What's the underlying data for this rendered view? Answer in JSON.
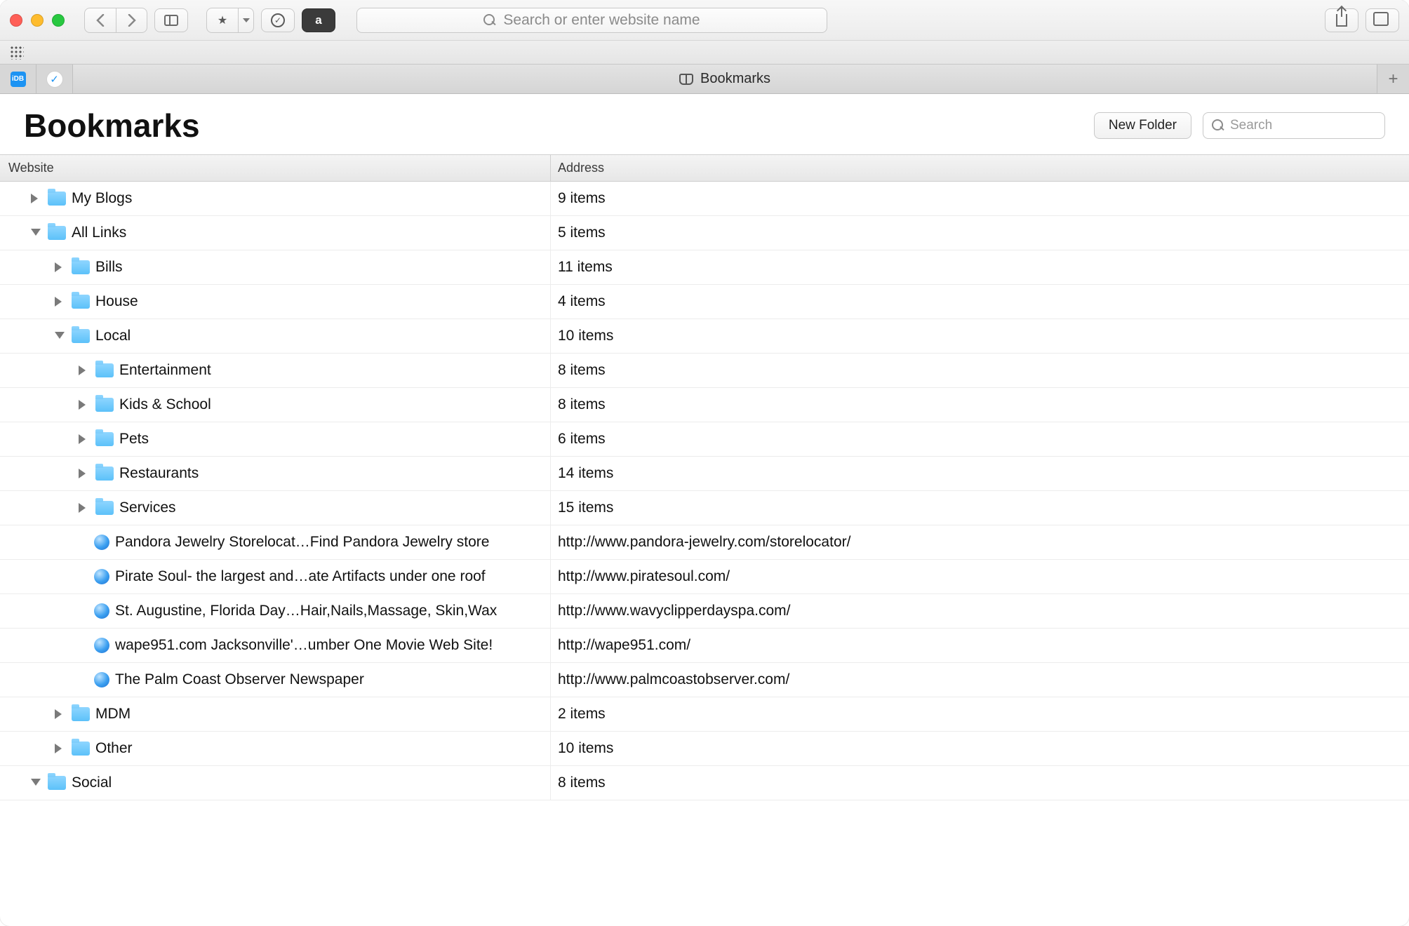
{
  "toolbar": {
    "address_placeholder": "Search or enter website name",
    "pinned_label": "iDB"
  },
  "tab": {
    "title": "Bookmarks"
  },
  "page": {
    "heading": "Bookmarks",
    "new_folder_label": "New Folder",
    "search_placeholder": "Search"
  },
  "columns": {
    "website": "Website",
    "address": "Address"
  },
  "rows": [
    {
      "indent": 0,
      "type": "folder",
      "expanded": false,
      "name": "My Blogs",
      "address": "9 items"
    },
    {
      "indent": 0,
      "type": "folder",
      "expanded": true,
      "name": "All Links",
      "address": "5 items"
    },
    {
      "indent": 1,
      "type": "folder",
      "expanded": false,
      "name": "Bills",
      "address": "11 items"
    },
    {
      "indent": 1,
      "type": "folder",
      "expanded": false,
      "name": "House",
      "address": "4 items"
    },
    {
      "indent": 1,
      "type": "folder",
      "expanded": true,
      "name": "Local",
      "address": "10 items"
    },
    {
      "indent": 2,
      "type": "folder",
      "expanded": false,
      "name": "Entertainment",
      "address": "8 items"
    },
    {
      "indent": 2,
      "type": "folder",
      "expanded": false,
      "name": "Kids & School",
      "address": "8 items"
    },
    {
      "indent": 2,
      "type": "folder",
      "expanded": false,
      "name": "Pets",
      "address": "6 items"
    },
    {
      "indent": 2,
      "type": "folder",
      "expanded": false,
      "name": "Restaurants",
      "address": "14 items"
    },
    {
      "indent": 2,
      "type": "folder",
      "expanded": false,
      "name": "Services",
      "address": "15 items"
    },
    {
      "indent": 2,
      "type": "bookmark",
      "name": "Pandora Jewelry Storelocat…Find Pandora Jewelry store",
      "address": "http://www.pandora-jewelry.com/storelocator/"
    },
    {
      "indent": 2,
      "type": "bookmark",
      "name": "Pirate Soul- the largest and…ate Artifacts under one roof",
      "address": "http://www.piratesoul.com/"
    },
    {
      "indent": 2,
      "type": "bookmark",
      "name": "St. Augustine, Florida Day…Hair,Nails,Massage, Skin,Wax",
      "address": "http://www.wavyclipperdayspa.com/"
    },
    {
      "indent": 2,
      "type": "bookmark",
      "name": "wape951.com Jacksonville'…umber One Movie Web Site!",
      "address": "http://wape951.com/"
    },
    {
      "indent": 2,
      "type": "bookmark",
      "name": "The Palm Coast Observer Newspaper",
      "address": "http://www.palmcoastobserver.com/"
    },
    {
      "indent": 1,
      "type": "folder",
      "expanded": false,
      "name": "MDM",
      "address": "2 items"
    },
    {
      "indent": 1,
      "type": "folder",
      "expanded": false,
      "name": "Other",
      "address": "10 items"
    },
    {
      "indent": 0,
      "type": "folder",
      "expanded": true,
      "name": "Social",
      "address": "8 items"
    }
  ]
}
